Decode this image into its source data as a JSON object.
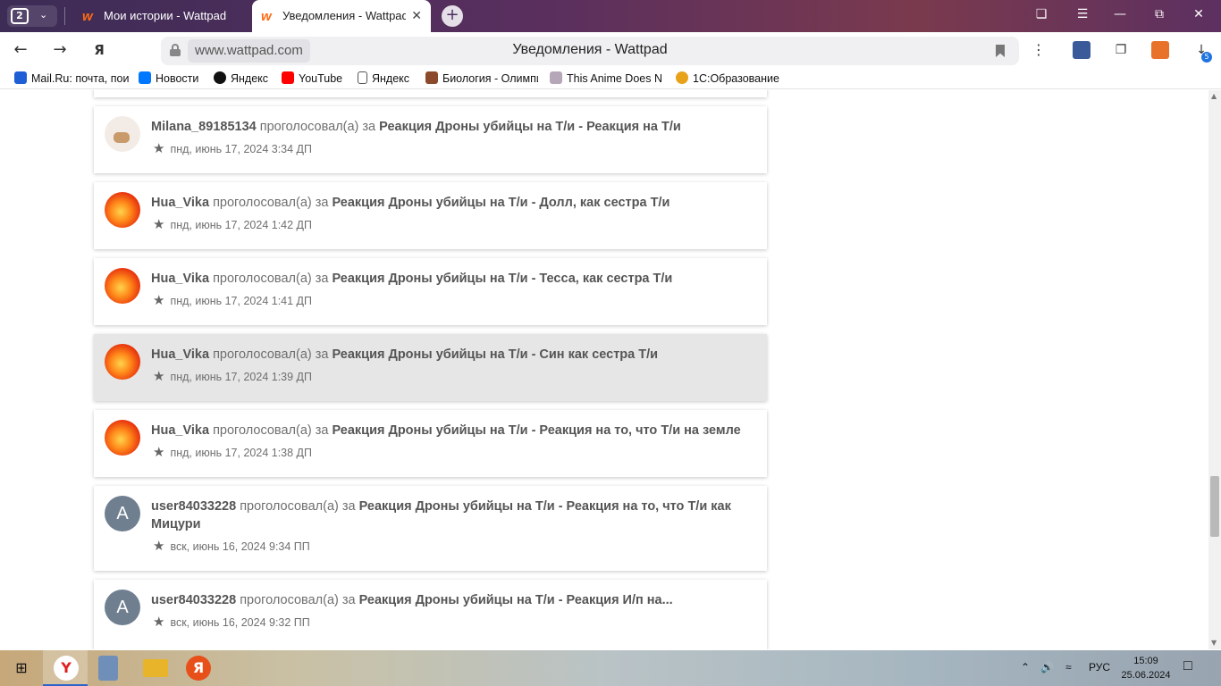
{
  "browser": {
    "tab_count": "2",
    "tabs": [
      {
        "label": "Мои истории - Wattpad"
      },
      {
        "label": "Уведомления - Wattpad"
      }
    ],
    "url_domain": "www.wattpad.com",
    "page_title": "Уведомления - Wattpad",
    "downloads_badge": "5"
  },
  "bookmarks": [
    {
      "label": "Mail.Ru: почта, поиск",
      "color": "#1e5fd6"
    },
    {
      "label": "Новости",
      "color": "#0077ff"
    },
    {
      "label": "Яндекс",
      "color": "#111111"
    },
    {
      "label": "YouTube",
      "color": "#ff0000"
    },
    {
      "label": "Яндекс",
      "color": "#ffffff"
    },
    {
      "label": "Биология - Олимпиада",
      "color": "#8b4a2b"
    },
    {
      "label": "This Anime Does Not Exist",
      "color": "#b5a6b8"
    },
    {
      "label": "1С:Образование",
      "color": "#e8a21a"
    }
  ],
  "notifications": [
    {
      "user": "Milana_89185134",
      "action": "проголосовал(а) за",
      "story": "Реакция Дроны убийцы на Т/и - Реакция на Т/и",
      "date": "пнд, июнь 17, 2024 3:34 ДП",
      "avatar": "cat"
    },
    {
      "user": "Hua_Vika",
      "action": "проголосовал(а) за",
      "story": "Реакция Дроны убийцы на Т/и - Долл, как сестра Т/и",
      "date": "пнд, июнь 17, 2024 1:42 ДП",
      "avatar": "fire"
    },
    {
      "user": "Hua_Vika",
      "action": "проголосовал(а) за",
      "story": "Реакция Дроны убийцы на Т/и - Тесса, как сестра Т/и",
      "date": "пнд, июнь 17, 2024 1:41 ДП",
      "avatar": "fire"
    },
    {
      "user": "Hua_Vika",
      "action": "проголосовал(а) за",
      "story": "Реакция Дроны убийцы на Т/и - Син как сестра Т/и",
      "date": "пнд, июнь 17, 2024 1:39 ДП",
      "avatar": "fire"
    },
    {
      "user": "Hua_Vika",
      "action": "проголосовал(а) за",
      "story": "Реакция Дроны убийцы на Т/и - Реакция на то, что Т/и на земле",
      "date": "пнд, июнь 17, 2024 1:38 ДП",
      "avatar": "fire"
    },
    {
      "user": "user84033228",
      "action": "проголосовал(а) за",
      "story": "Реакция Дроны убийцы на Т/и - Реакция на то, что Т/и как Мицури",
      "date": "вск, июнь 16, 2024 9:34 ПП",
      "avatar": "letter",
      "initial": "A"
    },
    {
      "user": "user84033228",
      "action": "проголосовал(а) за",
      "story": "Реакция Дроны убийцы на Т/и - Реакция И/п на...",
      "date": "вск, июнь 16, 2024 9:32 ПП",
      "avatar": "letter",
      "initial": "A"
    }
  ],
  "taskbar": {
    "language": "РУС",
    "time": "15:09",
    "date": "25.06.2024"
  }
}
